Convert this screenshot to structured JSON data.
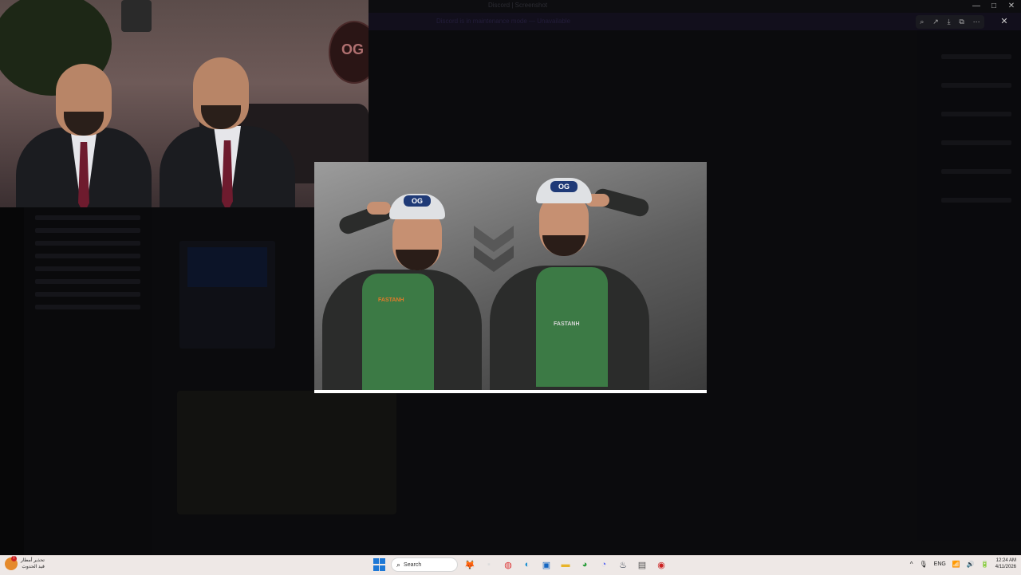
{
  "window": {
    "title": "Discord | Screenshot",
    "banner_text": "Discord is in maintenance mode — Unavailable",
    "buttons": [
      "—",
      "□",
      "✕"
    ]
  },
  "viewer": {
    "tools": [
      "⌕",
      "↗",
      "⤓",
      "⧉",
      "⋯"
    ],
    "close": "✕"
  },
  "webcam": {
    "logo": "OG"
  },
  "artwork": {
    "cap_badge_left": "OG",
    "cap_badge_right": "OG",
    "shirt_text_left": "FASTANH",
    "shirt_text_right": "FASTANH",
    "emblem": "OG"
  },
  "taskbar": {
    "weather_line1": "تحذير أمطار",
    "weather_line2": "قيد الحدوث",
    "weather_badge": "!",
    "search_placeholder": "Search",
    "pinned": [
      "🦊",
      "▪",
      "◍",
      "◐",
      "▣",
      "▬",
      "◕",
      "◔",
      "♨",
      "▤",
      "◉"
    ],
    "language": "ENG",
    "time": "12:24 AM",
    "date": "4/11/2026",
    "tray_icons": [
      "^",
      "🎙",
      "📶",
      "🔊",
      "🔋"
    ]
  }
}
